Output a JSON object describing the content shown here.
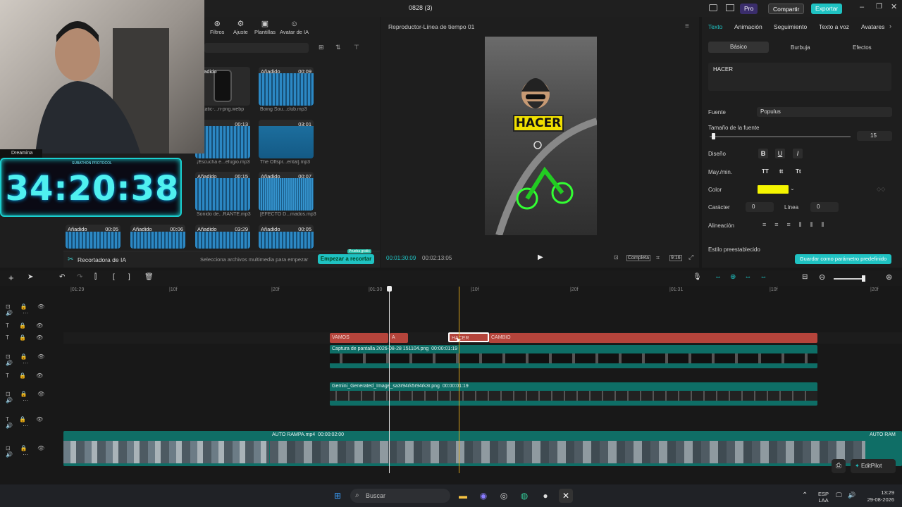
{
  "window": {
    "title": "0828 (3)",
    "pro": "Pro",
    "share": "Compartir",
    "export": "Exportar"
  },
  "media_toolbar": [
    "Filtros",
    "Ajuste",
    "Plantillas",
    "Avatar de IA"
  ],
  "media_cards": [
    {
      "tag": "Añadido",
      "dur": "",
      "name": "static-...n-png.webp"
    },
    {
      "tag": "Añadido",
      "dur": "00:09",
      "name": "Boing Sou...club.mp3"
    },
    {
      "tag": "",
      "dur": "00:13",
      "name": "¡Escucha e...efugio.mp3"
    },
    {
      "tag": "",
      "dur": "03:01",
      "name": "The Offspr...ental].mp3"
    },
    {
      "tag": "Añadido",
      "dur": "00:15",
      "name": "Sonido de...RANTE.mp3"
    },
    {
      "tag": "Añadido",
      "dur": "00:07",
      "name": "[EFECTO D...mados.mp3"
    },
    {
      "tag": "Añadido",
      "dur": "00:05",
      "name": ""
    },
    {
      "tag": "Añadido",
      "dur": "00:06",
      "name": ""
    },
    {
      "tag": "Añadido",
      "dur": "03:29",
      "name": ""
    },
    {
      "tag": "Añadido",
      "dur": "00:05",
      "name": ""
    }
  ],
  "overlay": {
    "dreamina": "Dreamina",
    "timer": "34:20:38",
    "stream_label": "SUBATHON PROTOCOL"
  },
  "recortadora": {
    "title": "Recortadora de IA",
    "hint": "Selecciona archivos multimedia para empezar",
    "button": "Empezar a recortar",
    "badge": "Prueba gratis"
  },
  "player": {
    "title": "Reproductor-Línea de tiempo 01",
    "current": "00:01:30:09",
    "total": "00:02:13:05",
    "overlay_text": "HACER",
    "full": "Completa",
    "ratio": "9:16"
  },
  "props": {
    "tabs": [
      "Texto",
      "Animación",
      "Seguimiento",
      "Texto a voz",
      "Avatares"
    ],
    "subtabs": [
      "Básico",
      "Burbuja",
      "Efectos"
    ],
    "text_value": "HACER",
    "font_label": "Fuente",
    "font_value": "Populus",
    "size_label": "Tamaño de la fuente",
    "size_value": "15",
    "design_label": "Diseño",
    "case_label": "May./min.",
    "case_opts": [
      "TT",
      "tt",
      "Tt"
    ],
    "color_label": "Color",
    "color_value": "#f5f500",
    "char_label": "Carácter",
    "char_value": "0",
    "line_label": "Línea",
    "line_value": "0",
    "align_label": "Alineación",
    "preset_label": "Estilo preestablecido",
    "save_preset": "Guardar como parámetro predefinido"
  },
  "ruler": [
    "|01:29",
    "|10f",
    "|20f",
    "|01:30",
    "|10f",
    "|20f",
    "|01:31",
    "|10f",
    "|20f"
  ],
  "text_clips": [
    "VAMOS",
    "A",
    "HACER",
    "CAMBIO"
  ],
  "clips": {
    "capture": {
      "name": "Captura de pantalla 2026-08-28 151104.png",
      "dur": "00:00:01:19"
    },
    "gemini": {
      "name": "Gemini_Generated_Image_sa3r94rk5r94rk3r.png",
      "dur": "00:00:01:19"
    },
    "main": {
      "name": "AUTO RAMPA.mp4",
      "dur": "00:00:02:00",
      "name2": "AUTO RAM"
    }
  },
  "editpilot": "EditPilot",
  "taskbar": {
    "search": "Buscar",
    "lang1": "ESP",
    "lang2": "LAA",
    "time": "13:29",
    "date": "29-08-2026"
  }
}
